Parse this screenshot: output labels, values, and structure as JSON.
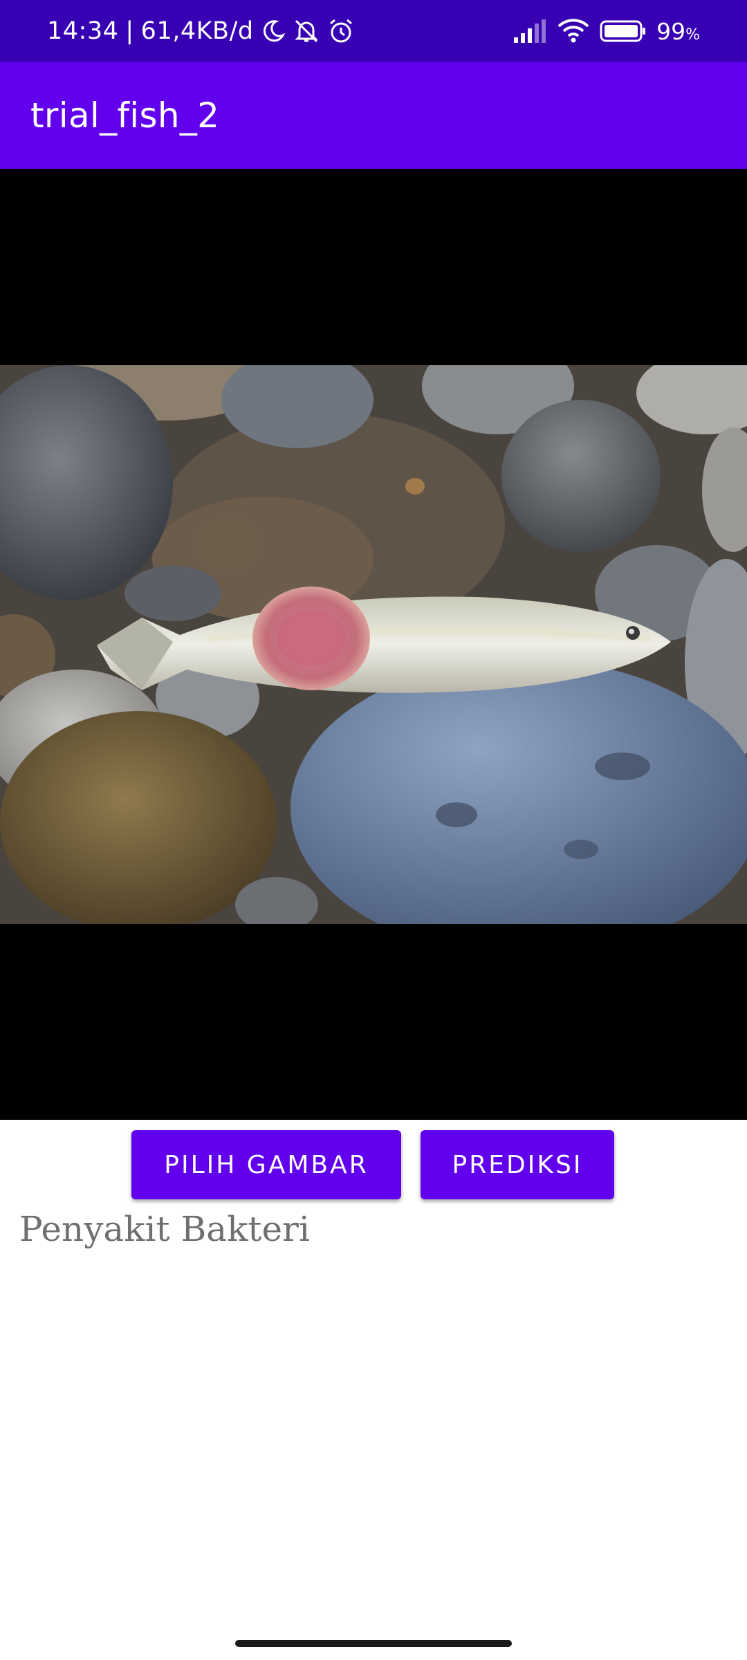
{
  "status_bar": {
    "time": "14:34",
    "separator": "|",
    "network_speed": "61,4KB/d",
    "battery_percent": "99",
    "battery_unit": "%",
    "icons": [
      "moon-icon",
      "silent-icon",
      "alarm-icon",
      "signal-icon",
      "wifi-icon",
      "battery-icon"
    ]
  },
  "app_bar": {
    "title": "trial_fish_2",
    "color": "#6200ee",
    "status_color": "#3700b3"
  },
  "image_view": {
    "description_icon": "fish-photo",
    "background": "#000000"
  },
  "actions": {
    "pick_image_label": "PILIH GAMBAR",
    "predict_label": "PREDIKSI"
  },
  "result": {
    "text": "Penyakit Bakteri"
  }
}
